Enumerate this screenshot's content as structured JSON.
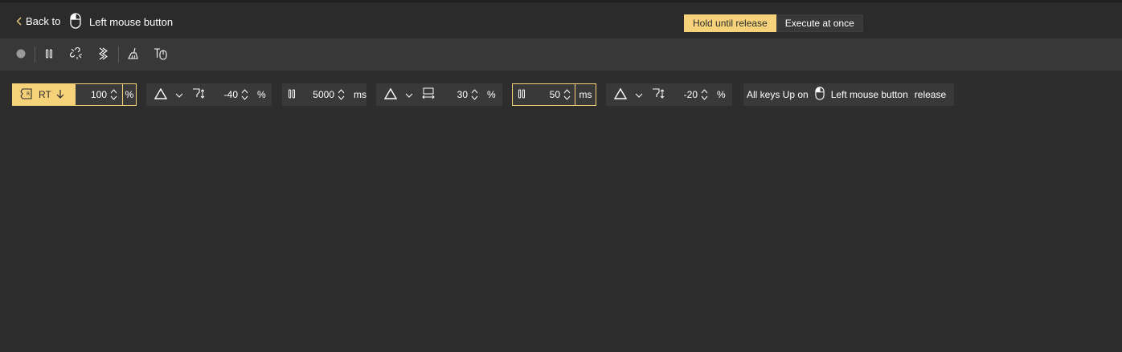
{
  "header": {
    "back_label": "Back to",
    "title": "Left mouse button",
    "modes": [
      {
        "label": "Hold until release",
        "active": true
      },
      {
        "label": "Execute at once",
        "active": false
      }
    ]
  },
  "toolbar": {
    "icons": [
      "record-icon",
      "pause-icon",
      "unlink-icon",
      "chain-icon",
      "broom-icon",
      "mouse-clear-icon"
    ]
  },
  "actions": {
    "trigger": {
      "key": "RT",
      "value": "100",
      "unit": "%"
    },
    "adjust1": {
      "value": "-40",
      "unit": "%"
    },
    "delay1": {
      "value": "5000",
      "unit": "ms"
    },
    "adjust2": {
      "value": "30",
      "unit": "%"
    },
    "delay2": {
      "value": "50",
      "unit": "ms"
    },
    "adjust3": {
      "value": "-20",
      "unit": "%"
    },
    "release": {
      "prefix": "All keys Up on",
      "target": "Left mouse button",
      "suffix": "release"
    }
  },
  "colors": {
    "accent": "#f6d37a",
    "background": "#2d2d2d",
    "toolbar": "#383838"
  }
}
